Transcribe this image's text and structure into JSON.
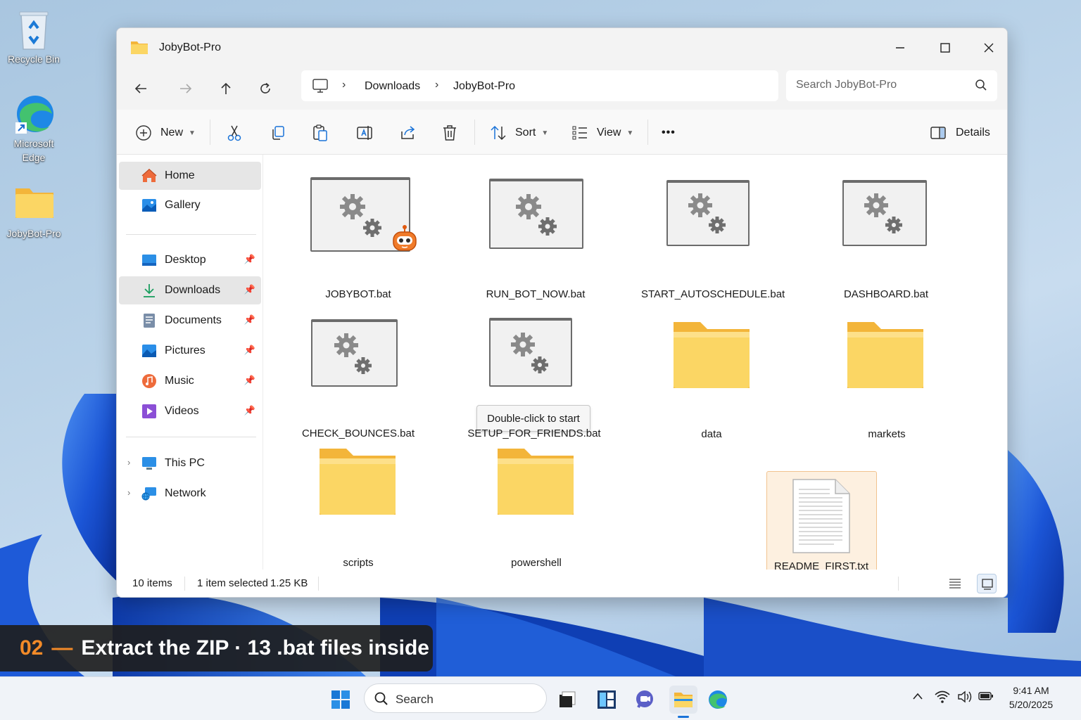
{
  "desktop": {
    "icons": [
      {
        "label": "Recycle Bin"
      },
      {
        "label": "Microsoft Edge"
      },
      {
        "label": "JobyBot-Pro"
      }
    ]
  },
  "window": {
    "title": "JobyBot-Pro",
    "controls": {
      "minimize": "—",
      "maximize": "☐",
      "close": "✕"
    }
  },
  "nav": {
    "breadcrumb": [
      "Downloads",
      "JobyBot-Pro"
    ],
    "search_placeholder": "Search JobyBot-Pro"
  },
  "commands": {
    "new_label": "New",
    "sort_label": "Sort",
    "view_label": "View",
    "more_label": "•••",
    "details_label": "Details"
  },
  "sidebar": {
    "items": [
      {
        "label": "Home",
        "icon": "home-icon"
      },
      {
        "label": "Gallery",
        "icon": "gallery-icon"
      },
      {
        "label": "Desktop",
        "icon": "desktop-icon"
      },
      {
        "label": "Downloads",
        "icon": "downloads-icon"
      },
      {
        "label": "Documents",
        "icon": "documents-icon"
      },
      {
        "label": "Pictures",
        "icon": "pictures-icon"
      },
      {
        "label": "Music",
        "icon": "music-icon"
      },
      {
        "label": "Videos",
        "icon": "videos-icon"
      },
      {
        "label": "This PC",
        "icon": "this-pc-icon"
      },
      {
        "label": "Network",
        "icon": "network-icon"
      }
    ]
  },
  "files": [
    {
      "name": "JOBYBOT.bat",
      "type": "bat"
    },
    {
      "name": "RUN_BOT_NOW.bat",
      "type": "bat"
    },
    {
      "name": "START_AUTOSCHEDULE.bat",
      "type": "bat"
    },
    {
      "name": "DASHBOARD.bat",
      "type": "bat"
    },
    {
      "name": "CHECK_BOUNCES.bat",
      "type": "bat"
    },
    {
      "name": "SETUP_FOR_FRIENDS.bat",
      "type": "bat"
    },
    {
      "name": "data",
      "type": "folder"
    },
    {
      "name": "markets",
      "type": "folder"
    },
    {
      "name": "scripts",
      "type": "folder"
    },
    {
      "name": "powershell",
      "type": "folder"
    },
    {
      "name": "README_FIRST.txt",
      "type": "txt"
    }
  ],
  "tooltip": "Double-click to start",
  "status": {
    "count": "10 items",
    "selected": "1 item selected",
    "size": "1.25 KB"
  },
  "banner": {
    "step": "02",
    "dash": "—",
    "text": "Extract the ZIP · 13 .bat files inside"
  },
  "taskbar": {
    "search_label": "Search",
    "time": "9:41 AM",
    "date": "5/20/2025"
  },
  "colors": {
    "accent_orange": "#f28a28",
    "folder_yellow": "#f8c84a",
    "selection_fill": "#fdf0e0"
  }
}
